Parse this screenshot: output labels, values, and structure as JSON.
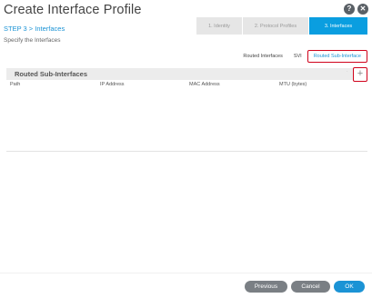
{
  "dialog": {
    "title": "Create Interface Profile",
    "help_icon": "question-mark-icon",
    "close_icon": "close-icon"
  },
  "wizard": {
    "steps": [
      {
        "label": "1. Identity",
        "active": false
      },
      {
        "label": "2. Protocol Profiles",
        "active": false
      },
      {
        "label": "3. Interfaces",
        "active": true
      }
    ]
  },
  "step": {
    "label": "STEP 3 > Interfaces",
    "subtitle": "Specify the Interfaces"
  },
  "subtabs": [
    {
      "label": "Routed Interfaces",
      "active": false
    },
    {
      "label": "SVI",
      "active": false
    },
    {
      "label": "Routed Sub-Interface",
      "active": true
    }
  ],
  "section": {
    "title": "Routed Sub-Interfaces",
    "add_label": "+"
  },
  "table": {
    "columns": [
      "Path",
      "IP Address",
      "MAC Address",
      "MTU (bytes)"
    ],
    "rows": []
  },
  "footer": {
    "previous": "Previous",
    "cancel": "Cancel",
    "ok": "OK"
  },
  "colors": {
    "accent": "#1b93d5",
    "highlight": "#d0021b",
    "wizard_active": "#0a9ee0"
  }
}
